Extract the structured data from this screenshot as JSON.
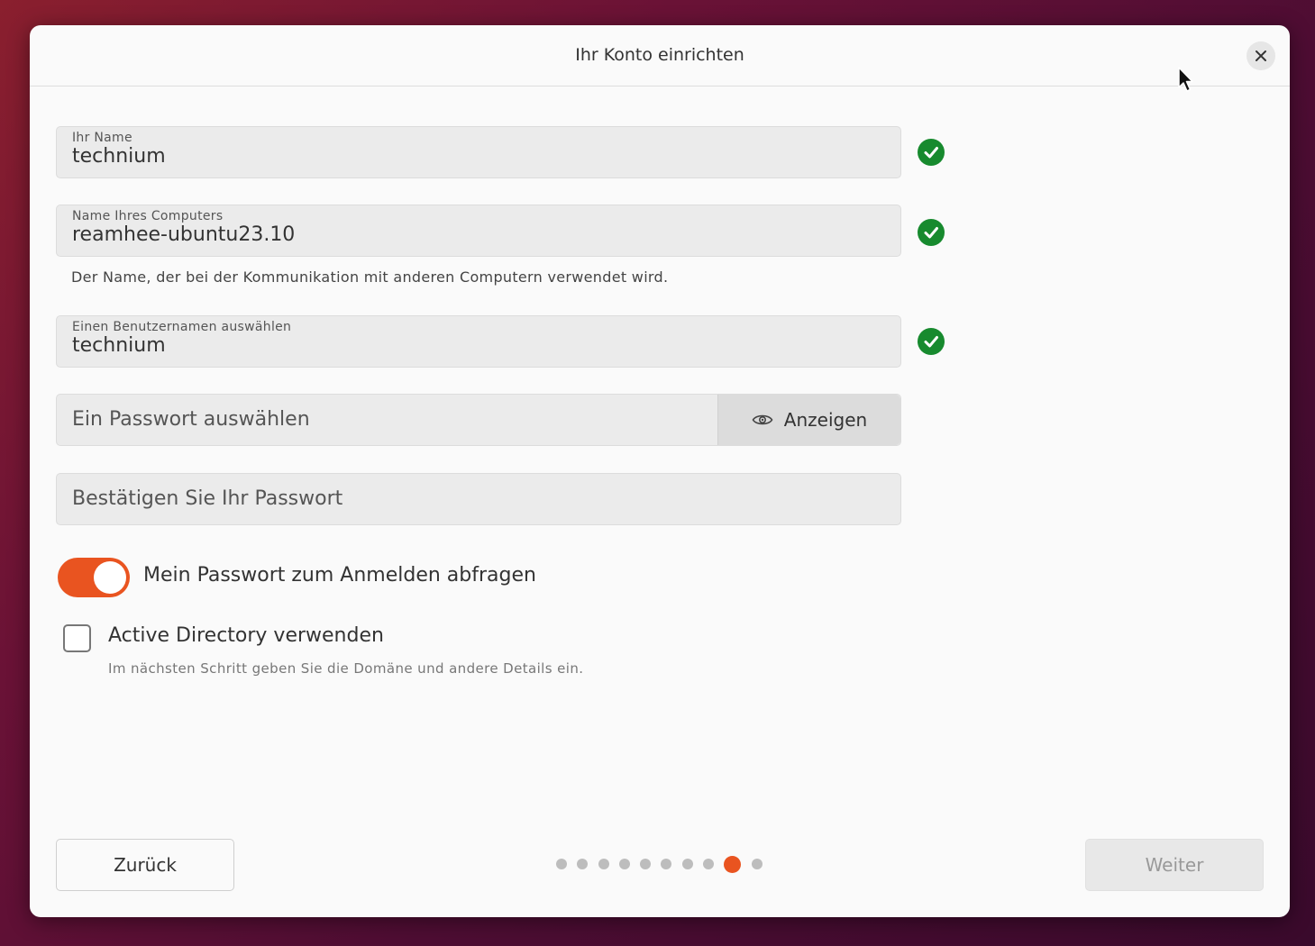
{
  "dialog": {
    "title": "Ihr Konto einrichten"
  },
  "fields": {
    "name": {
      "label": "Ihr Name",
      "value": "technium",
      "valid": true
    },
    "computer": {
      "label": "Name Ihres Computers",
      "value": "reamhee-ubuntu23.10",
      "valid": true,
      "hint": "Der Name, der bei der Kommunikation mit anderen Computern verwendet wird."
    },
    "username": {
      "label": "Einen Benutzernamen auswählen",
      "value": "technium",
      "valid": true
    },
    "password": {
      "placeholder": "Ein Passwort auswählen",
      "show_label": "Anzeigen"
    },
    "confirm": {
      "placeholder": "Bestätigen Sie Ihr Passwort"
    }
  },
  "options": {
    "require_password": {
      "label": "Mein Passwort zum Anmelden abfragen",
      "enabled": true
    },
    "active_directory": {
      "label": "Active Directory verwenden",
      "hint": "Im nächsten Schritt geben Sie die Domäne und andere Details ein.",
      "checked": false
    }
  },
  "navigation": {
    "back_label": "Zurück",
    "next_label": "Weiter",
    "next_enabled": false,
    "steps_total": 10,
    "current_step": 9
  },
  "icons": {
    "close": "close-icon",
    "valid": "check-circle-icon",
    "show_password": "eye-icon"
  },
  "colors": {
    "accent": "#e95420",
    "valid": "#178a2e"
  }
}
